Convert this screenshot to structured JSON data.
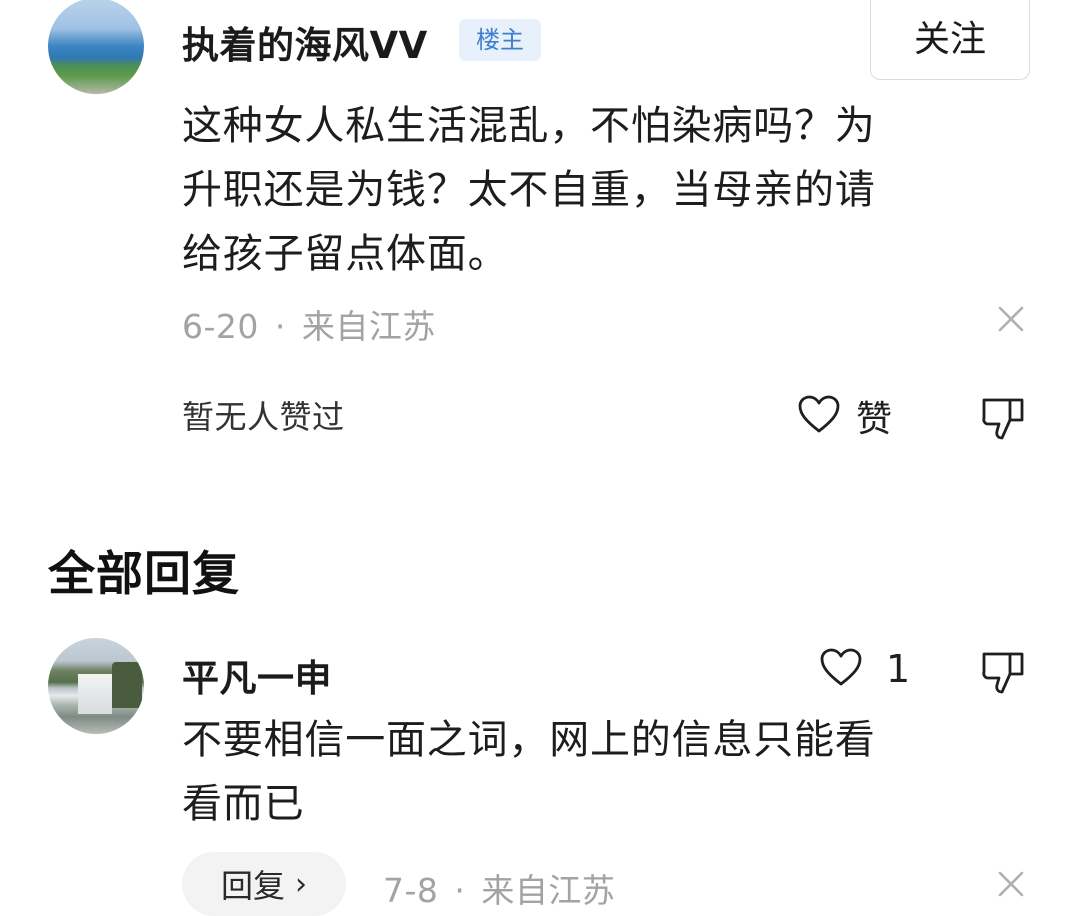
{
  "post": {
    "author": "执着的海风VV",
    "author_tag": "楼主",
    "follow_label": "关注",
    "avatar_icon": "sea-landscape-avatar",
    "text_lines": [
      "这种女人私生活混乱，不怕染病吗？为",
      "升职还是为钱？太不自重，当母亲的请",
      "给孩子留点体面。"
    ],
    "date": "6-20",
    "separator": "·",
    "location": "来自江苏",
    "no_likes_text": "暂无人赞过",
    "like_label": "赞"
  },
  "section_title": "全部回复",
  "reply": {
    "author": "平凡一申",
    "avatar_icon": "waterfall-avatar",
    "like_count": "1",
    "text_lines": [
      "不要相信一面之词，网上的信息只能看",
      "看而已"
    ],
    "reply_button": "回复",
    "reply_chevron": "›",
    "date": "7-8",
    "separator": "·",
    "location": "来自江苏"
  },
  "colors": {
    "tag_bg": "#e8f1fb",
    "tag_text": "#3f7fcf",
    "meta_text": "#a3a3a3"
  }
}
